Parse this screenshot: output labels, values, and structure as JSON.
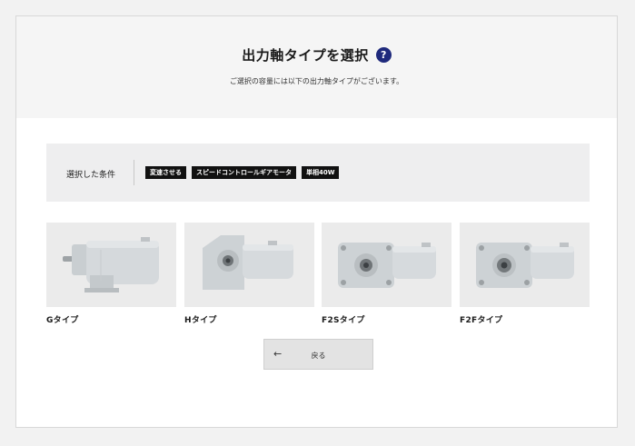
{
  "header": {
    "title": "出力軸タイプを選択",
    "help_glyph": "?",
    "subtitle": "ご選択の容量には以下の出力軸タイプがございます。"
  },
  "conditions": {
    "label": "選択した条件",
    "tags": [
      "変速させる",
      "スピードコントロールギアモータ",
      "単相40W"
    ]
  },
  "shaft_types": [
    {
      "label": "Gタイプ",
      "icon": "gearmotor-g-type"
    },
    {
      "label": "Hタイプ",
      "icon": "gearmotor-h-type"
    },
    {
      "label": "F2Sタイプ",
      "icon": "gearmotor-f2s-type"
    },
    {
      "label": "F2Fタイプ",
      "icon": "gearmotor-f2f-type"
    }
  ],
  "back_button": {
    "arrow": "←",
    "label": "戻る"
  },
  "colors": {
    "help_icon": "#1f2a7c",
    "tag_bg": "#111111",
    "header_bg": "#f5f5f5",
    "conditions_bg": "#eeeeef",
    "card_bg": "#ebebeb"
  }
}
